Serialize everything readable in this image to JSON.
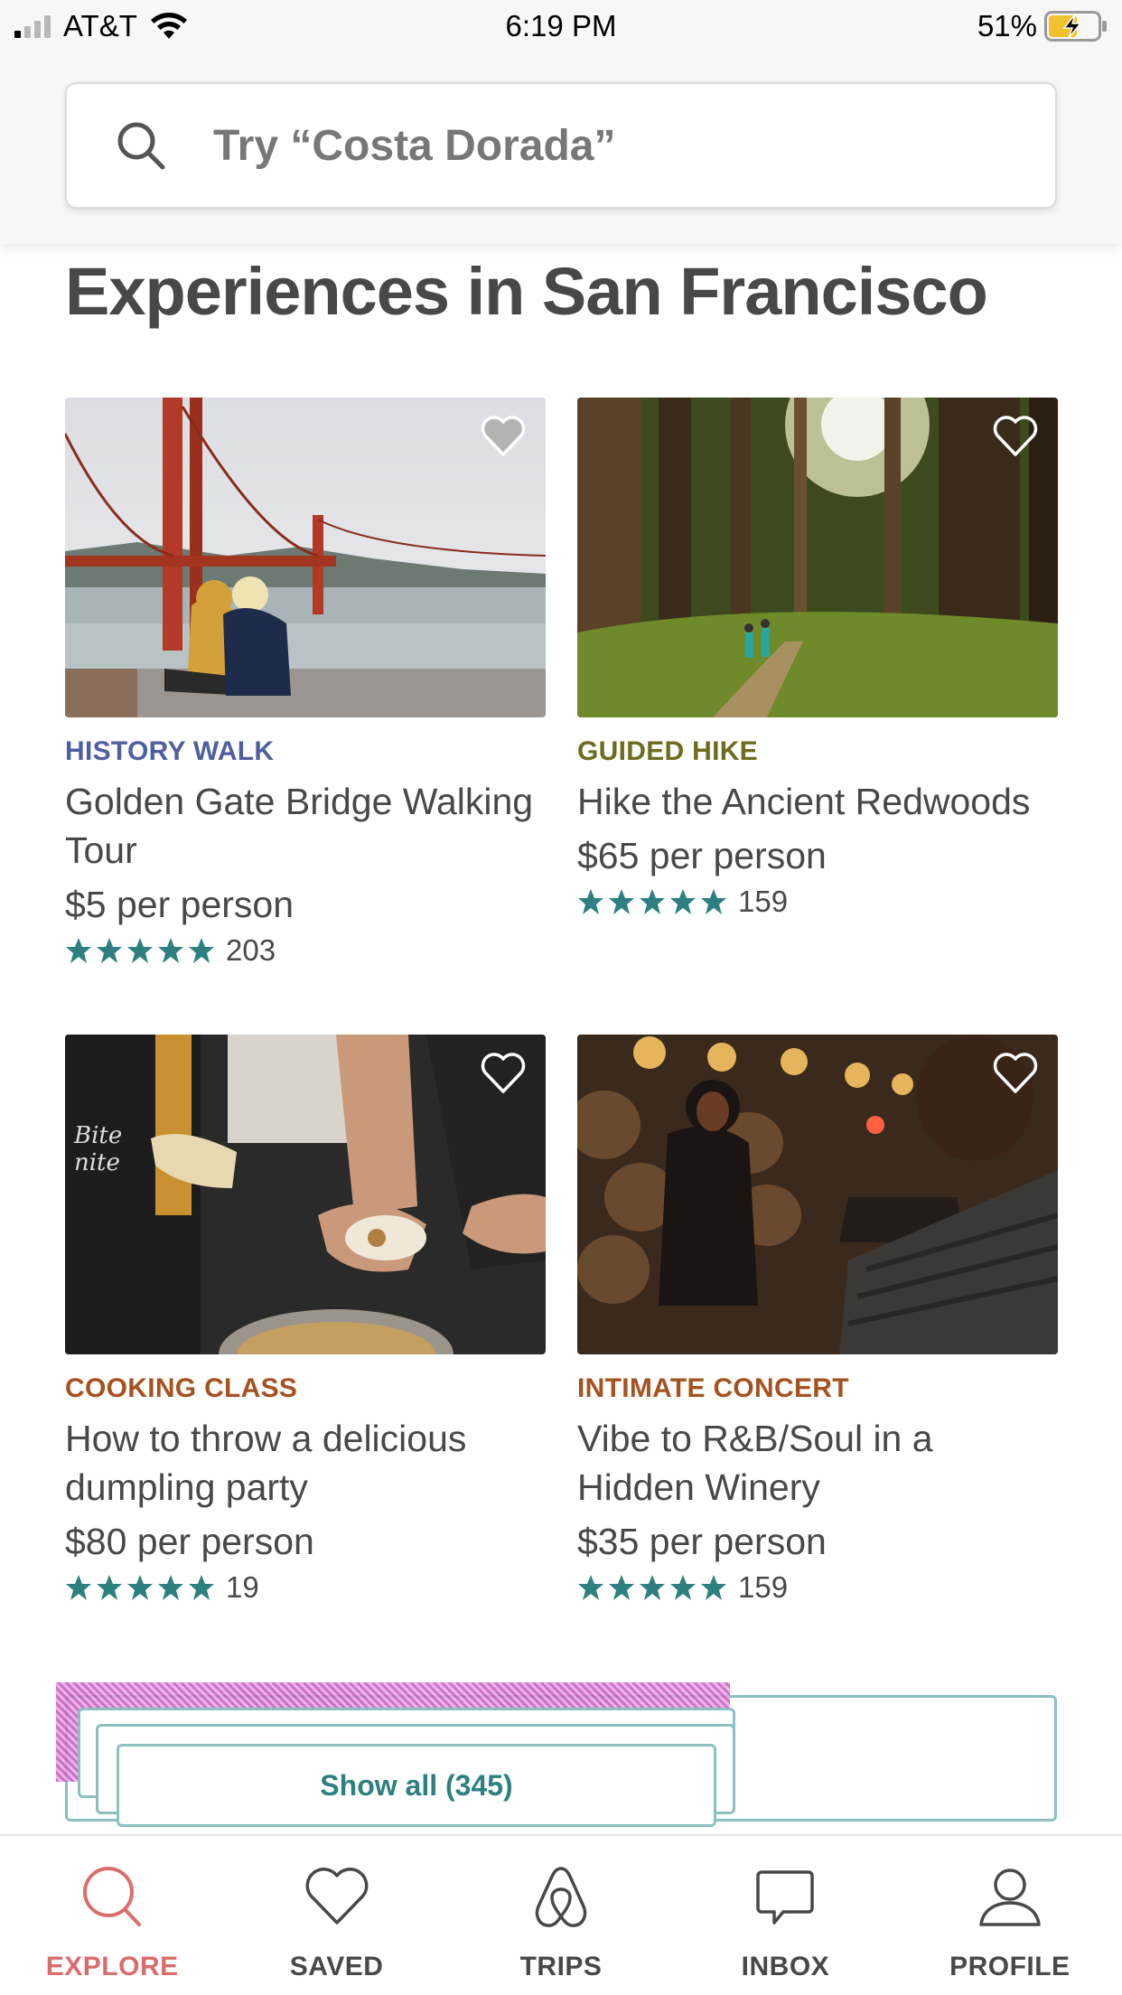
{
  "status_bar": {
    "carrier": "AT&T",
    "time": "6:19 PM",
    "battery": "51%"
  },
  "search": {
    "placeholder": "Try “Costa Dorada”",
    "icon": "search-icon"
  },
  "section_title": "Experiences in San Francisco",
  "cards": [
    {
      "category": "HISTORY WALK",
      "category_color": "#4d5f9e",
      "title": "Golden Gate Bridge Walking Tour",
      "price": "$5 per person",
      "stars": 5,
      "reviews": "203",
      "heart": "heart-icon",
      "image": "golden-gate-bridge-photo"
    },
    {
      "category": "GUIDED HIKE",
      "category_color": "#6e6b1f",
      "title": "Hike the Ancient Redwoods",
      "price": "$65 per person",
      "stars": 5,
      "reviews": "159",
      "heart": "heart-icon",
      "image": "redwood-forest-photo"
    },
    {
      "category": "COOKING CLASS",
      "category_color": "#a5521f",
      "title": "How to throw a delicious dumpling party",
      "price": "$80 per person",
      "stars": 5,
      "reviews": "19",
      "heart": "heart-icon",
      "image": "dumpling-making-photo"
    },
    {
      "category": "INTIMATE CONCERT",
      "category_color": "#a5521f",
      "title": "Vibe to R&B/Soul in a Hidden Winery",
      "price": "$35 per person",
      "stars": 5,
      "reviews": "159",
      "heart": "heart-icon",
      "image": "winery-concert-photo"
    }
  ],
  "show_all": "Show all (345)",
  "colors": {
    "accent": "#ff5a5f",
    "teal": "#2e8080",
    "star": "#2e8080",
    "active_nav": "#d96d6b"
  },
  "nav": [
    {
      "label": "EXPLORE",
      "icon": "search-icon",
      "active": true
    },
    {
      "label": "SAVED",
      "icon": "heart-icon",
      "active": false
    },
    {
      "label": "TRIPS",
      "icon": "airbnb-logo-icon",
      "active": false
    },
    {
      "label": "INBOX",
      "icon": "chat-bubble-icon",
      "active": false
    },
    {
      "label": "PROFILE",
      "icon": "person-icon",
      "active": false
    }
  ]
}
